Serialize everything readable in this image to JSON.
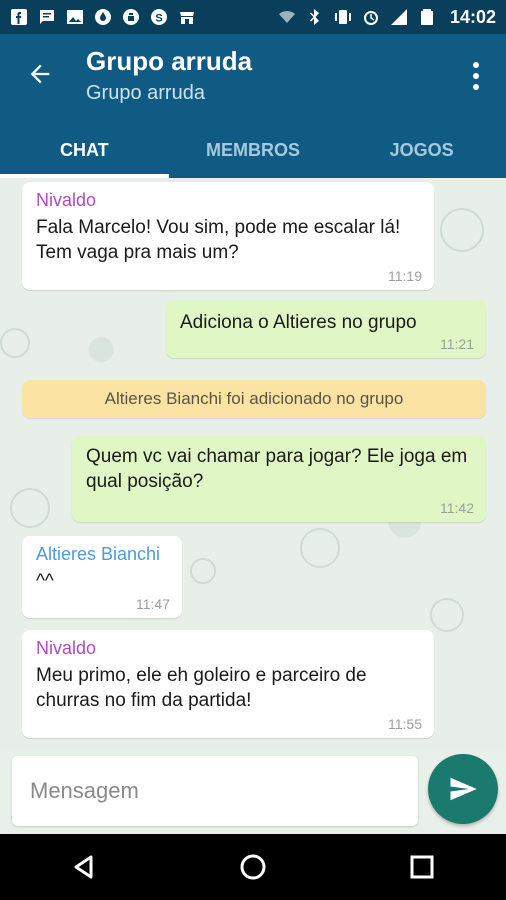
{
  "status_bar": {
    "time": "14:02",
    "left_icons": [
      "facebook-icon",
      "message-icon",
      "image-icon",
      "drop-icon",
      "whatsapp-icon",
      "skype-icon",
      "store-icon"
    ],
    "right_icons": [
      "wifi-icon",
      "bluetooth-icon",
      "vibrate-icon",
      "alarm-icon",
      "signal-icon",
      "battery-icon"
    ]
  },
  "header": {
    "title": "Grupo arruda",
    "subtitle": "Grupo arruda"
  },
  "tabs": [
    {
      "label": "CHAT",
      "active": true
    },
    {
      "label": "MEMBROS",
      "active": false
    },
    {
      "label": "JOGOS",
      "active": false
    }
  ],
  "messages": [
    {
      "type": "in",
      "sender": "Nivaldo",
      "sender_color": "#b04bc5",
      "text": "Fala Marcelo! Vou sim, pode me escalar lá! Tem vaga pra mais um?",
      "time": "11:19"
    },
    {
      "type": "out",
      "text": "Adiciona o Altieres no grupo",
      "time": "11:21"
    },
    {
      "type": "system",
      "text": "Altieres Bianchi foi adicionado no grupo"
    },
    {
      "type": "out",
      "text": "Quem vc vai chamar para jogar? Ele joga em qual posição?",
      "time": "11:42"
    },
    {
      "type": "in",
      "sender": "Altieres Bianchi",
      "sender_color": "#4a9be0",
      "text": "^^",
      "time": "11:47"
    },
    {
      "type": "in",
      "sender": "Nivaldo",
      "sender_color": "#b04bc5",
      "text": "Meu primo, ele eh goleiro e parceiro de churras no fim da partida!",
      "time": "11:55"
    }
  ],
  "composer": {
    "placeholder": "Mensagem"
  },
  "colors": {
    "app_bar": "#0f5b83",
    "status_bar": "#0a3f5c",
    "send_button": "#1a7a6e",
    "outgoing_bubble": "#e0f7c5",
    "system_notice": "#fbe3a3"
  }
}
